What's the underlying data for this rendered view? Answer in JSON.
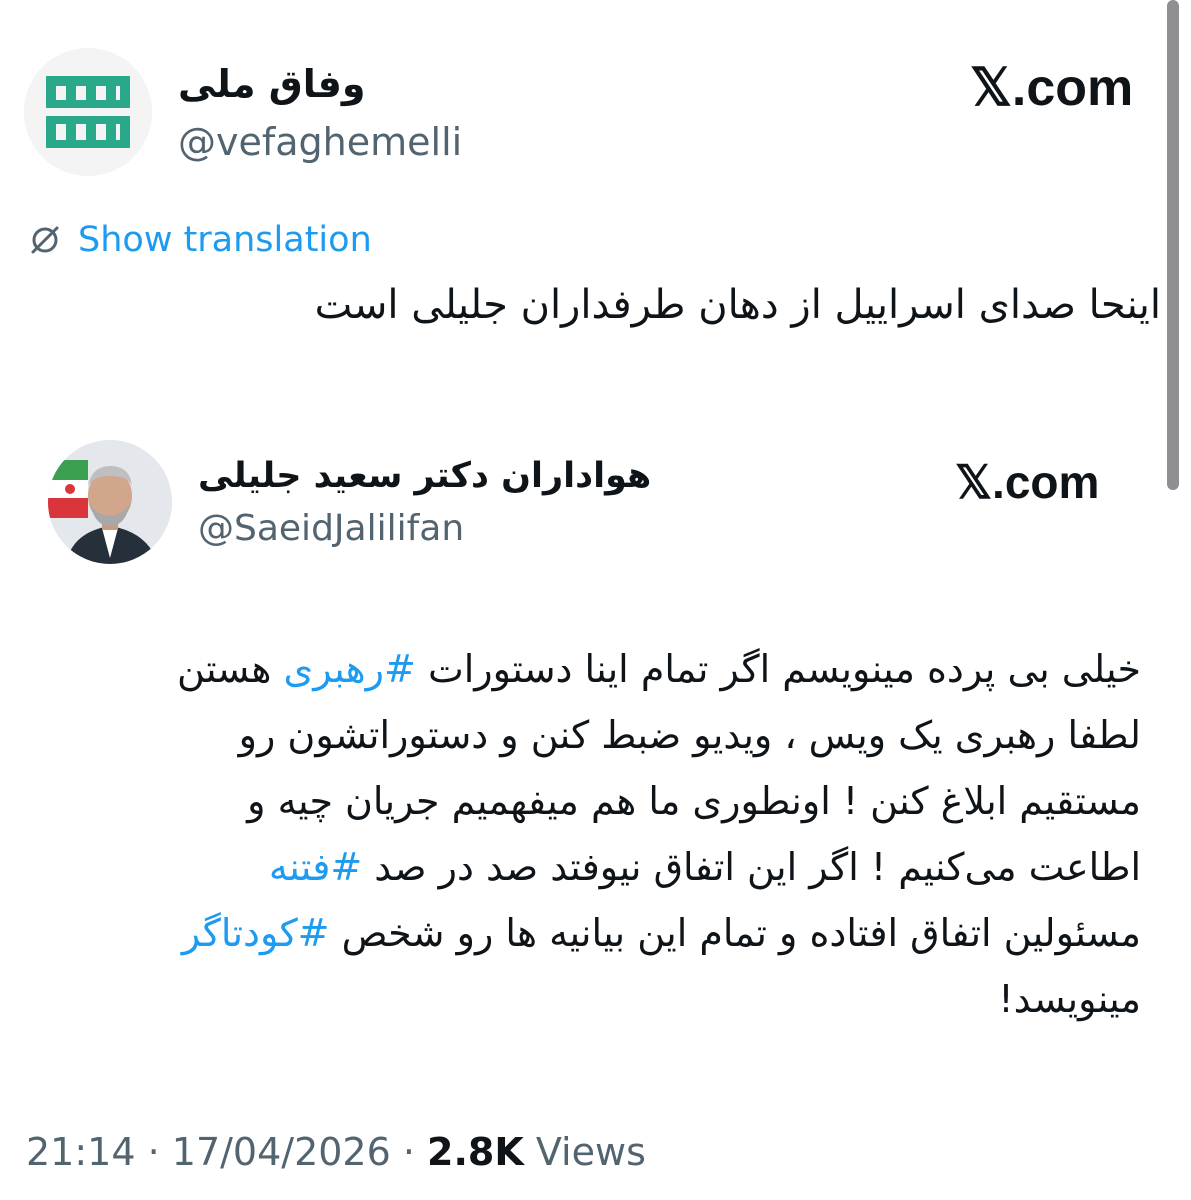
{
  "outer_tweet": {
    "display_name": "وفاق ملی",
    "handle": "@vefaghemelli",
    "brand": "𝕏.com",
    "show_translation": "Show translation",
    "text": "اینحا صدای اسراییل از دهان طرفداران جلیلی است",
    "avatar_logo_color": "#2aa88a"
  },
  "inner_tweet": {
    "display_name": "هواداران دکتر سعید جلیلی",
    "handle": "@SaeidJalilifan",
    "brand": "𝕏.com",
    "lines": [
      {
        "before": "خیلی بی پرده مینویسم اگر تمام اینا دستورات ",
        "tag": "#رهبری",
        "after": " هستن"
      },
      {
        "before": "لطفا رهبری یک ویس ، ویدیو ضبط کنن و دستوراتشون رو",
        "tag": "",
        "after": ""
      },
      {
        "before": "مستقیم ابلاغ کنن ! اونطوری ما هم میفهمیم جریان چیه و",
        "tag": "",
        "after": ""
      },
      {
        "before": "اطاعت می‌کنیم ! اگر این اتفاق نیوفتد صد در صد ",
        "tag": "#فتنه",
        "after": ""
      },
      {
        "before": "مسئولین اتفاق افتاده و تمام این بیانیه ها رو شخص ",
        "tag": "#کودتاگر",
        "after": ""
      },
      {
        "before": "مینویسد!",
        "tag": "",
        "after": ""
      }
    ]
  },
  "footer": {
    "time": "21:14",
    "sep1": " · ",
    "date": "17/04/2026",
    "sep2": " · ",
    "views_count": "2.8K",
    "views_label": " Views"
  },
  "colors": {
    "link_blue": "#1d9bf0",
    "muted": "#536471",
    "text": "#0f1419"
  },
  "icons": {
    "translate": "translate-icon",
    "outer_avatar": "vefagh-logo-avatar",
    "inner_avatar": "user-photo-avatar"
  }
}
